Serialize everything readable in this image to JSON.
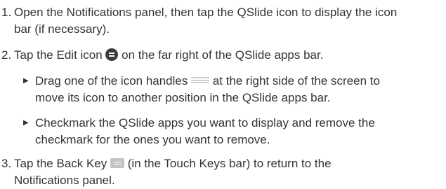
{
  "steps": [
    {
      "number": "1.",
      "line1": "Open the Notifications panel, then tap the QSlide icon to display the icon",
      "line2": "bar (if necessary)."
    },
    {
      "number": "2.",
      "pre": "Tap the ",
      "keyword": "Edit",
      "mid": " icon ",
      "icon": "edit-icon",
      "post": " on the far right of the QSlide apps bar.",
      "bullets": [
        {
          "pre": "Drag one of the icon handles ",
          "icon": "drag-handle-icon",
          "post": " at the right side of the screen to",
          "line2": "move its icon to another position in the QSlide apps bar."
        },
        {
          "line1": "Checkmark the QSlide apps you want to display and remove the",
          "line2": "checkmark for the ones you want to remove."
        }
      ]
    },
    {
      "number": "3.",
      "pre": "Tap the ",
      "keyword": "Back Key",
      "icon": "back-key-icon",
      "post": " (in the Touch Keys bar) to return to the",
      "line2": "Notifications panel."
    }
  ],
  "bullet_marker": "▶"
}
